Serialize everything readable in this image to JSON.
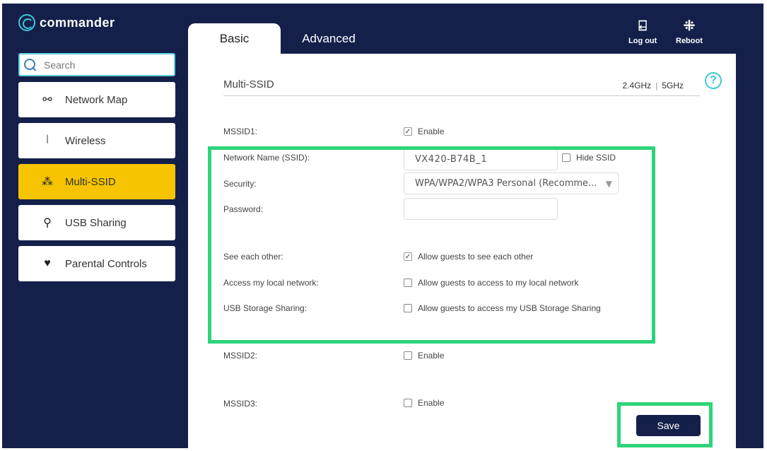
{
  "brand": {
    "name": "commander"
  },
  "search": {
    "placeholder": "Search"
  },
  "sidebar": {
    "items": [
      {
        "label": "Network Map",
        "icon": "network-map-icon",
        "glyph": "⚯"
      },
      {
        "label": "Wireless",
        "icon": "wireless-icon",
        "glyph": "⦚"
      },
      {
        "label": "Multi-SSID",
        "icon": "multi-users-icon",
        "glyph": "⁂",
        "active": true
      },
      {
        "label": "USB Sharing",
        "icon": "usb-icon",
        "glyph": "⚲"
      },
      {
        "label": "Parental Controls",
        "icon": "heart-icon",
        "glyph": "♥"
      }
    ]
  },
  "tabs": [
    {
      "label": "Basic",
      "active": true
    },
    {
      "label": "Advanced"
    }
  ],
  "topbar": {
    "logout_label": "Log out",
    "reboot_label": "Reboot"
  },
  "section": {
    "title": "Multi-SSID",
    "band_24": "2.4GHz",
    "band_5": "5GHz",
    "help": "?"
  },
  "form": {
    "mssid1": {
      "label": "MSSID1:",
      "enable_label": "Enable",
      "enabled": true
    },
    "ssid": {
      "label": "Network Name (SSID):",
      "value": "VX420-B74B_1",
      "hide_label": "Hide SSID",
      "hidden": false
    },
    "security": {
      "label": "Security:",
      "value": "WPA/WPA2/WPA3 Personal (Recomme..."
    },
    "password": {
      "label": "Password:",
      "value": ""
    },
    "see_each_other": {
      "label": "See each other:",
      "option": "Allow guests to see each other",
      "checked": true
    },
    "local_network": {
      "label": "Access my local network:",
      "option": "Allow guests to access to my local network",
      "checked": false
    },
    "usb_storage": {
      "label": "USB Storage Sharing:",
      "option": "Allow guests to access my USB Storage Sharing",
      "checked": false
    },
    "mssid2": {
      "label": "MSSID2:",
      "enable_label": "Enable",
      "enabled": false
    },
    "mssid3": {
      "label": "MSSID3:",
      "enable_label": "Enable",
      "enabled": false
    }
  },
  "actions": {
    "save_label": "Save"
  },
  "colors": {
    "navy": "#14204a",
    "accent_yellow": "#f6c400",
    "cyan": "#3cc8d6",
    "highlight_green": "#2ed47a"
  }
}
